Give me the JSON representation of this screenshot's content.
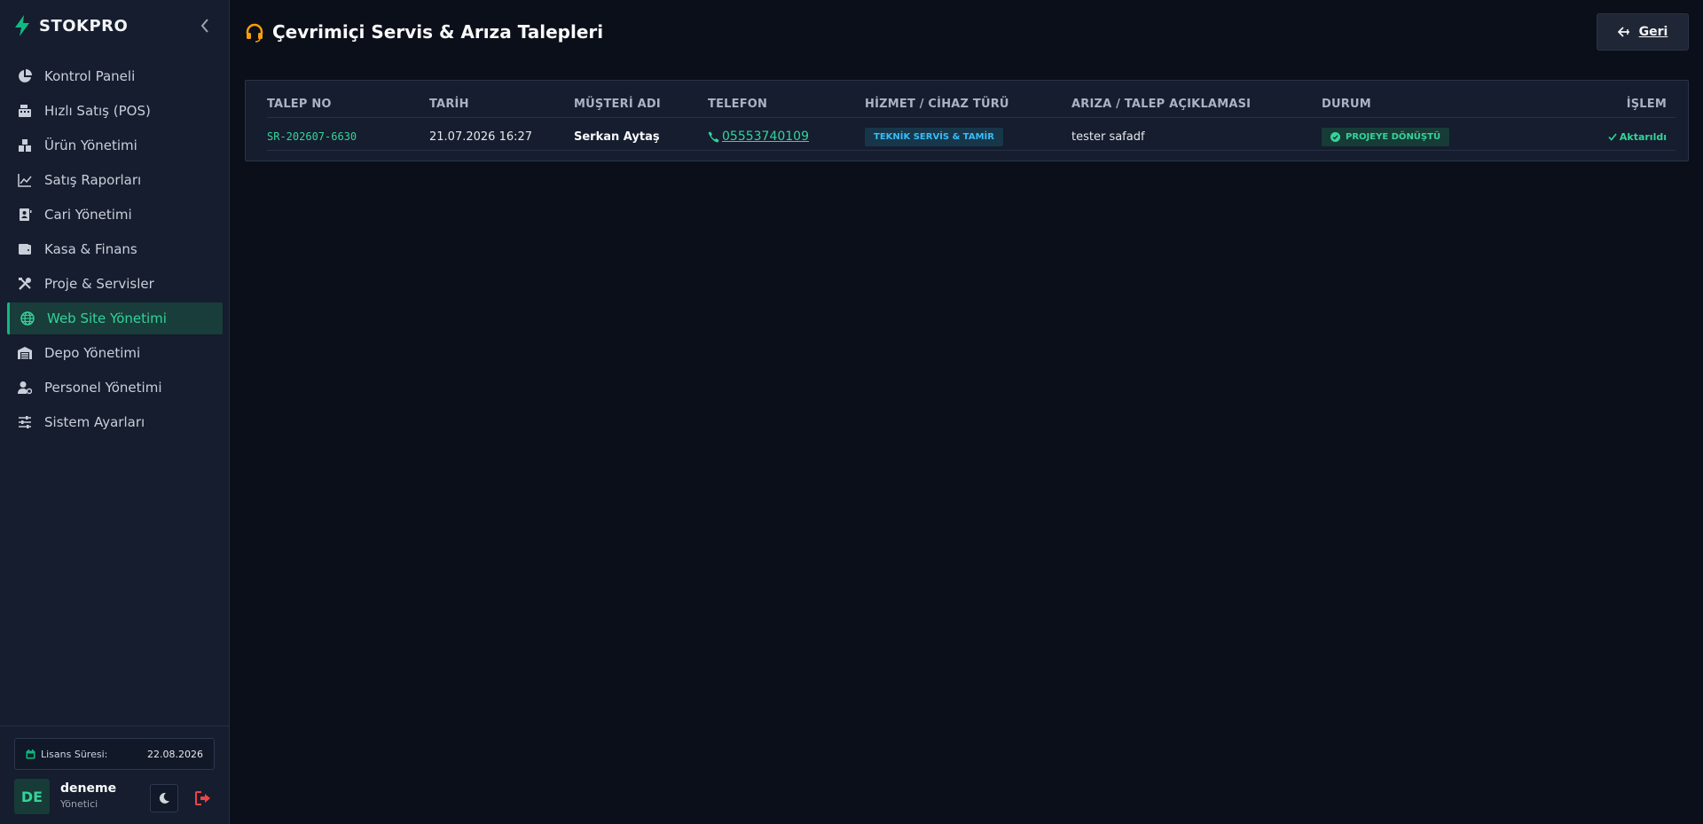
{
  "app": {
    "name": "STOKPRO"
  },
  "sidebar": {
    "items": [
      {
        "label": "Kontrol Paneli",
        "icon": "pie-chart-icon"
      },
      {
        "label": "Hızlı Satış (POS)",
        "icon": "cash-register-icon"
      },
      {
        "label": "Ürün Yönetimi",
        "icon": "boxes-icon"
      },
      {
        "label": "Satış Raporları",
        "icon": "line-chart-icon"
      },
      {
        "label": "Cari Yönetimi",
        "icon": "contact-card-icon"
      },
      {
        "label": "Kasa & Finans",
        "icon": "wallet-icon"
      },
      {
        "label": "Proje & Servisler",
        "icon": "tools-icon"
      },
      {
        "label": "Web Site Yönetimi",
        "icon": "globe-icon",
        "active": true
      },
      {
        "label": "Depo Yönetimi",
        "icon": "warehouse-icon"
      },
      {
        "label": "Personel Yönetimi",
        "icon": "user-gear-icon"
      },
      {
        "label": "Sistem Ayarları",
        "icon": "sliders-icon"
      }
    ],
    "license": {
      "label": "Lisans Süresi:",
      "value": "22.08.2026"
    },
    "user": {
      "initials": "DE",
      "name": "deneme",
      "role": "Yönetici"
    }
  },
  "page": {
    "title": "Çevrimiçi Servis & Arıza Talepleri",
    "back_label": "Geri"
  },
  "table": {
    "columns": [
      "TALEP NO",
      "TARİH",
      "MÜŞTERİ ADI",
      "TELEFON",
      "HİZMET / CİHAZ TÜRÜ",
      "ARIZA / TALEP AÇIKLAMASI",
      "DURUM",
      "İŞLEM"
    ],
    "rows": [
      {
        "request_no": "SR-202607-6630",
        "date": "21.07.2026 16:27",
        "customer": "Serkan Aytaş",
        "phone": "05553740109",
        "service_type": "TEKNİK SERVİS & TAMİR",
        "description": "tester safadf",
        "status": "PROJEYE DÖNÜŞTÜ",
        "action": "Aktarıldı"
      }
    ]
  },
  "colors": {
    "accent": "#10b981",
    "accent_text": "#34d399",
    "info": "#38bdf8",
    "danger": "#ef4444",
    "warning": "#f59e0b",
    "background": "#0b0f19",
    "sidebar": "#151d2e"
  }
}
